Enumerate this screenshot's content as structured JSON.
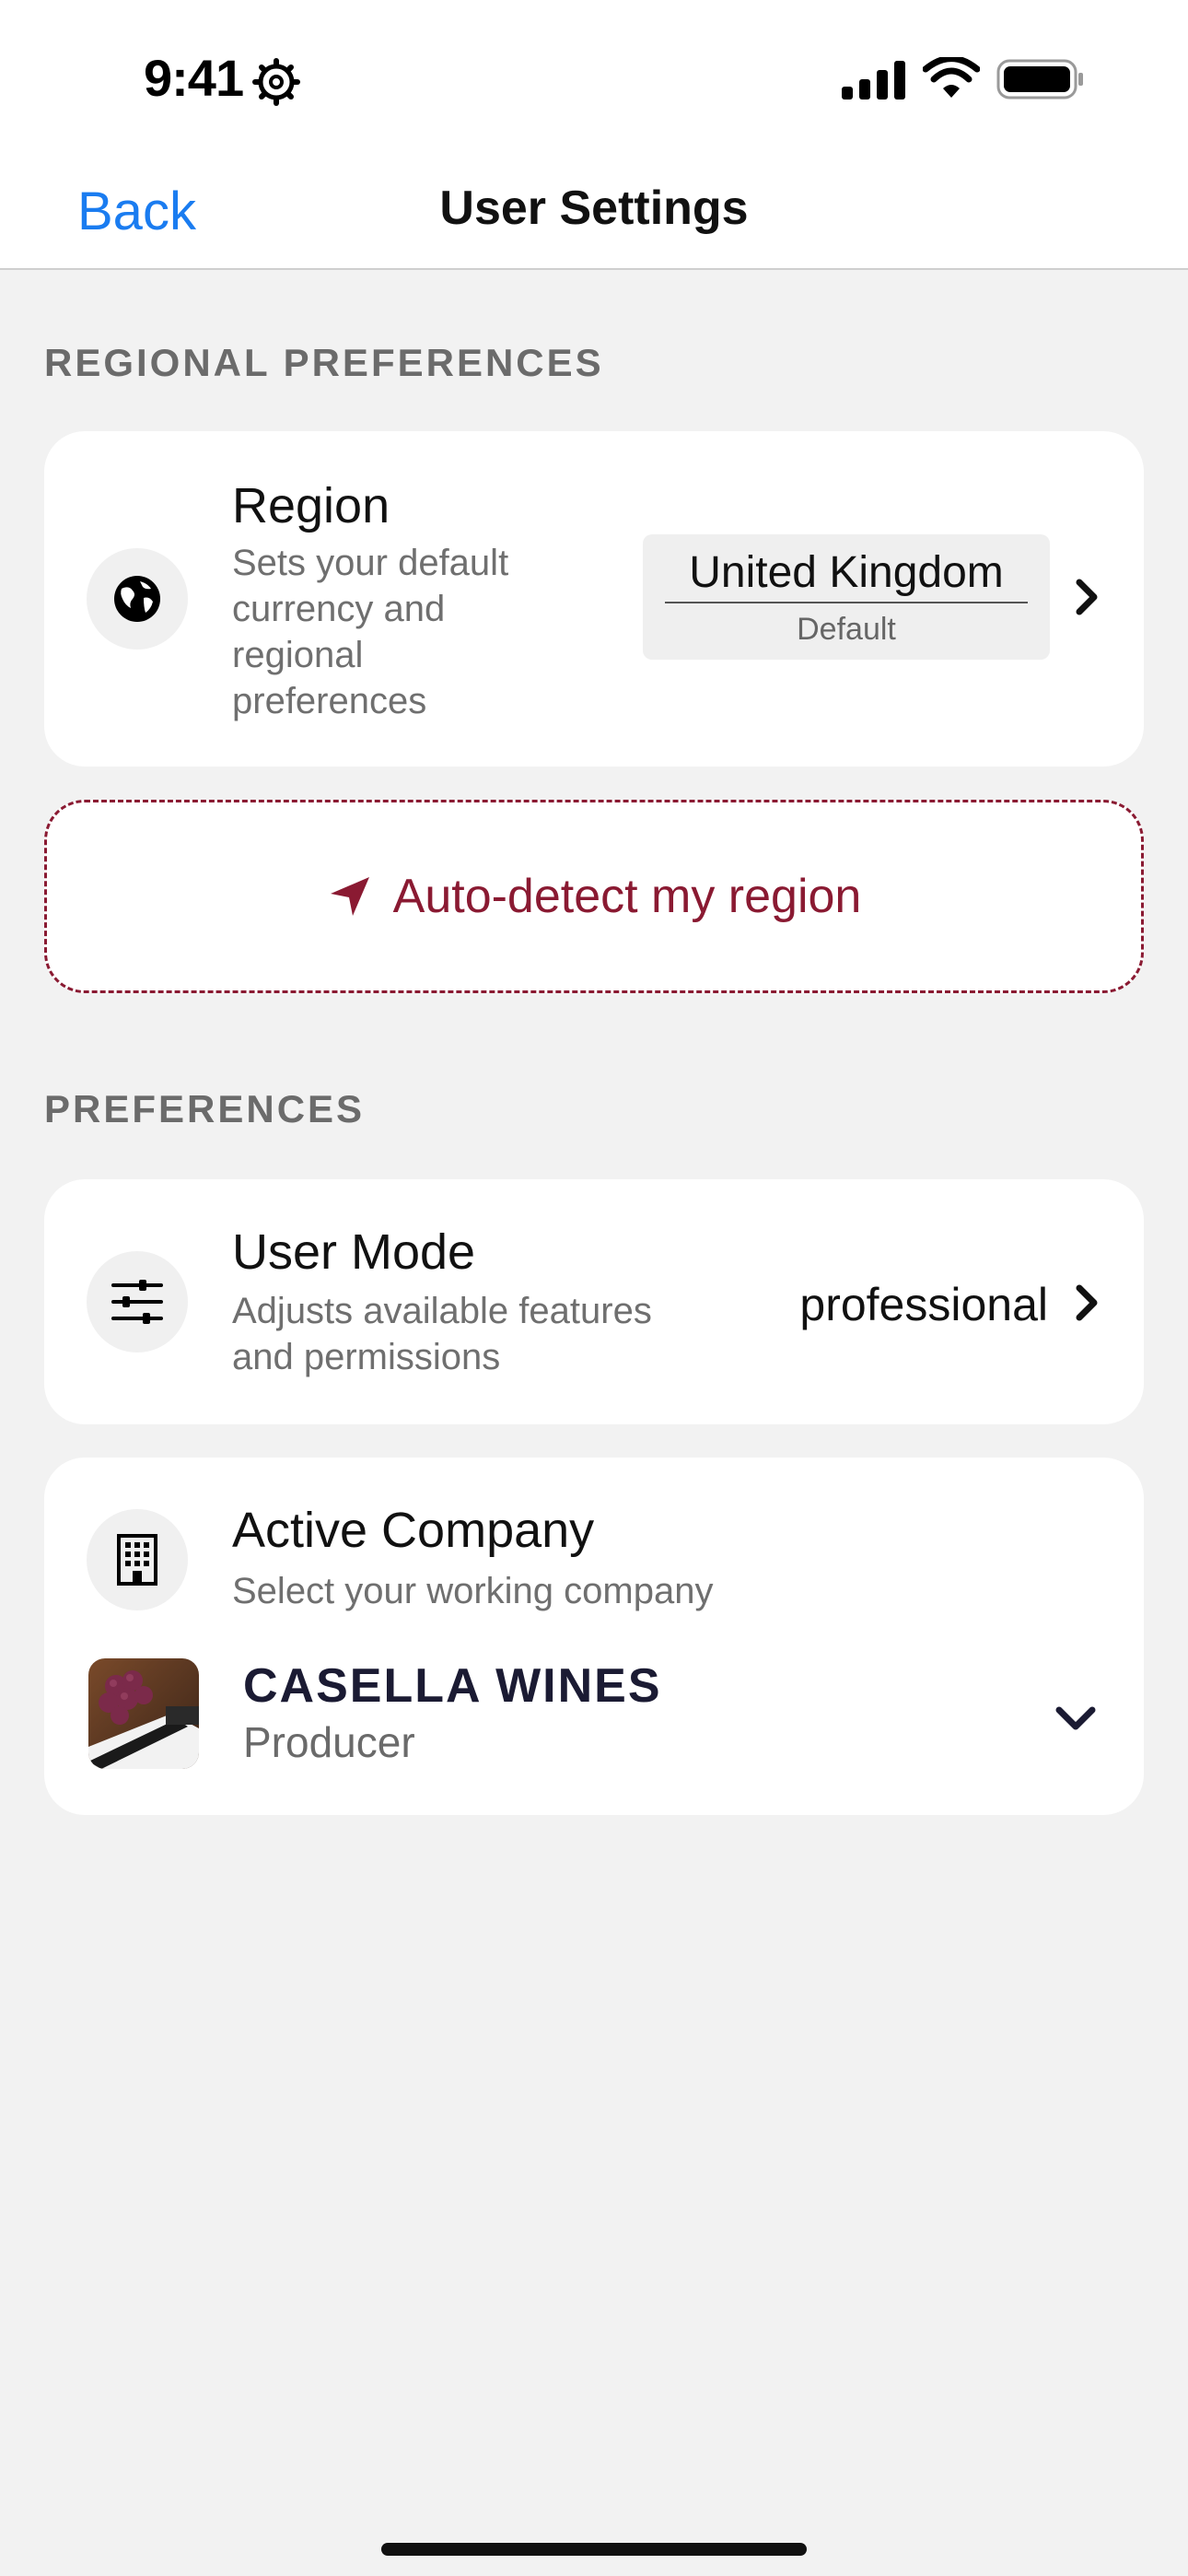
{
  "status_bar": {
    "time": "9:41",
    "icons": [
      "gear-icon",
      "signal-icon",
      "wifi-icon",
      "battery-icon"
    ]
  },
  "nav": {
    "back_label": "Back",
    "title": "User Settings"
  },
  "regional": {
    "header": "REGIONAL PREFERENCES",
    "region": {
      "icon": "globe-icon",
      "title": "Region",
      "subtitle_lines": [
        "Sets your default",
        "currency and",
        "regional",
        "preferences"
      ],
      "value": "United Kingdom",
      "value_note": "Default"
    },
    "auto_detect": {
      "icon": "location-arrow-icon",
      "label": "Auto-detect my region"
    }
  },
  "preferences": {
    "header": "PREFERENCES",
    "user_mode": {
      "icon": "sliders-icon",
      "title": "User Mode",
      "subtitle_lines": [
        "Adjusts available features",
        "and permissions"
      ],
      "value": "professional"
    },
    "active_company": {
      "icon": "building-icon",
      "title": "Active Company",
      "subtitle": "Select your working company",
      "company_name": "CASELLA WINES",
      "company_role": "Producer"
    }
  },
  "colors": {
    "accent_blue": "#1a7cf0",
    "accent_wine": "#8a1a32",
    "background": "#f2f2f2",
    "card": "#ffffff"
  }
}
